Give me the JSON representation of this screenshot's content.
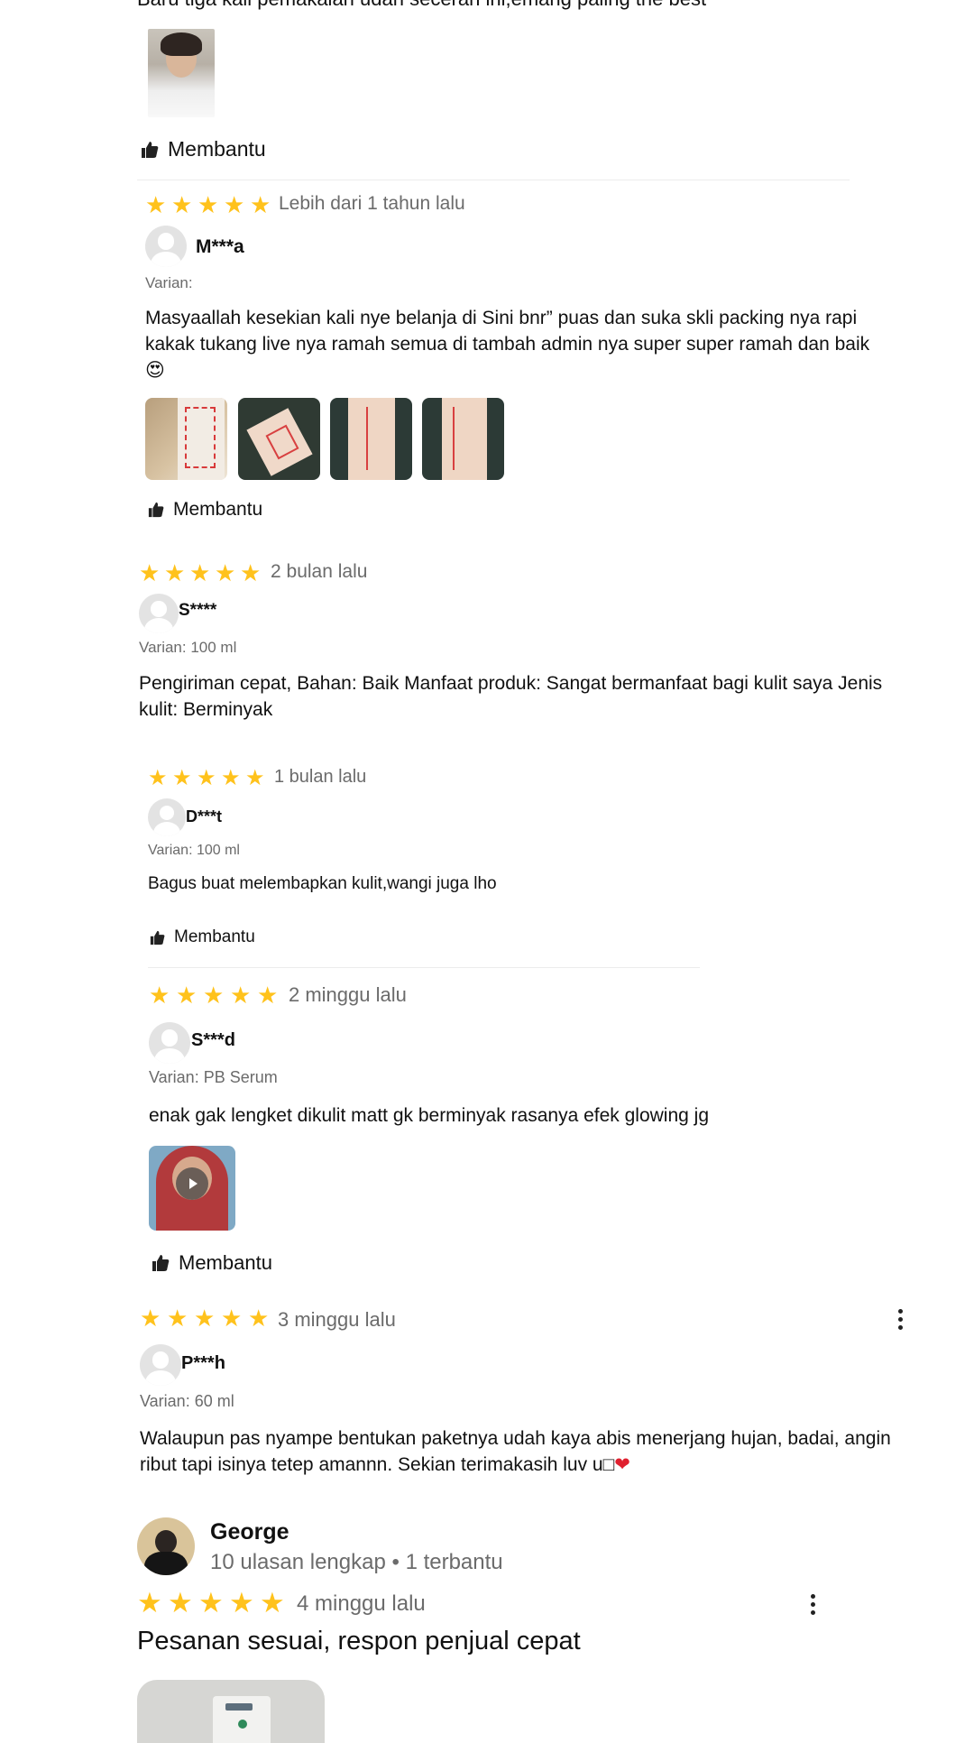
{
  "colors": {
    "star": "#ffc21c",
    "muted": "#6b6b6b",
    "text": "#111111",
    "heart": "#e0202f"
  },
  "top_fragment": {
    "text": "Baru tiga kali pemakaian udah seceran ini,emang paling the best",
    "helpful": "Membantu",
    "helpful_icon": "thumbs-up-icon"
  },
  "reviews": [
    {
      "time": "Lebih dari 1 tahun lalu",
      "rating": 5,
      "name": "M***a",
      "variant": "Varian:",
      "text": "Masyaallah kesekian kali nye belanja di Sini   bnr” puas dan suka skli packing nya rapi kakak tukang live nya ramah semua di tambah admin nya super super ramah dan baik",
      "emoji": "😍",
      "photo_count": 4,
      "helpful": "Membantu"
    },
    {
      "time": "2 bulan lalu",
      "rating": 5,
      "name": "S****",
      "variant": "Varian: 100 ml",
      "text": "Pengiriman cepat, Bahan: Baik Manfaat produk: Sangat bermanfaat bagi kulit saya Jenis kulit: Berminyak"
    },
    {
      "time": "1 bulan lalu",
      "rating": 5,
      "name": "D***t",
      "variant": "Varian: 100 ml",
      "text": "Bagus buat melembapkan kulit,wangi juga lho",
      "helpful": "Membantu"
    },
    {
      "time": "2 minggu lalu",
      "rating": 5,
      "name": "S***d",
      "variant": "Varian: PB Serum",
      "text": "enak gak lengket dikulit matt gk berminyak rasanya efek glowing jg",
      "video_icon": "play-icon",
      "helpful": "Membantu"
    },
    {
      "time": "3 minggu lalu",
      "rating": 5,
      "name": "P***h",
      "variant": "Varian: 60 ml",
      "text": "Walaupun pas nyampe bentukan paketnya udah kaya abis menerjang hujan, badai, angin ribut tapi isinya tetep amannn. Sekian terimakasih luv u□",
      "heart": "❤",
      "menu_icon": "more-vertical-icon"
    },
    {
      "name": "George",
      "meta": "10 ulasan lengkap • 1 terbantu",
      "time": "4 minggu lalu",
      "rating": 5,
      "text": "Pesanan sesuai, respon penjual cepat",
      "menu_icon": "more-vertical-icon"
    }
  ]
}
